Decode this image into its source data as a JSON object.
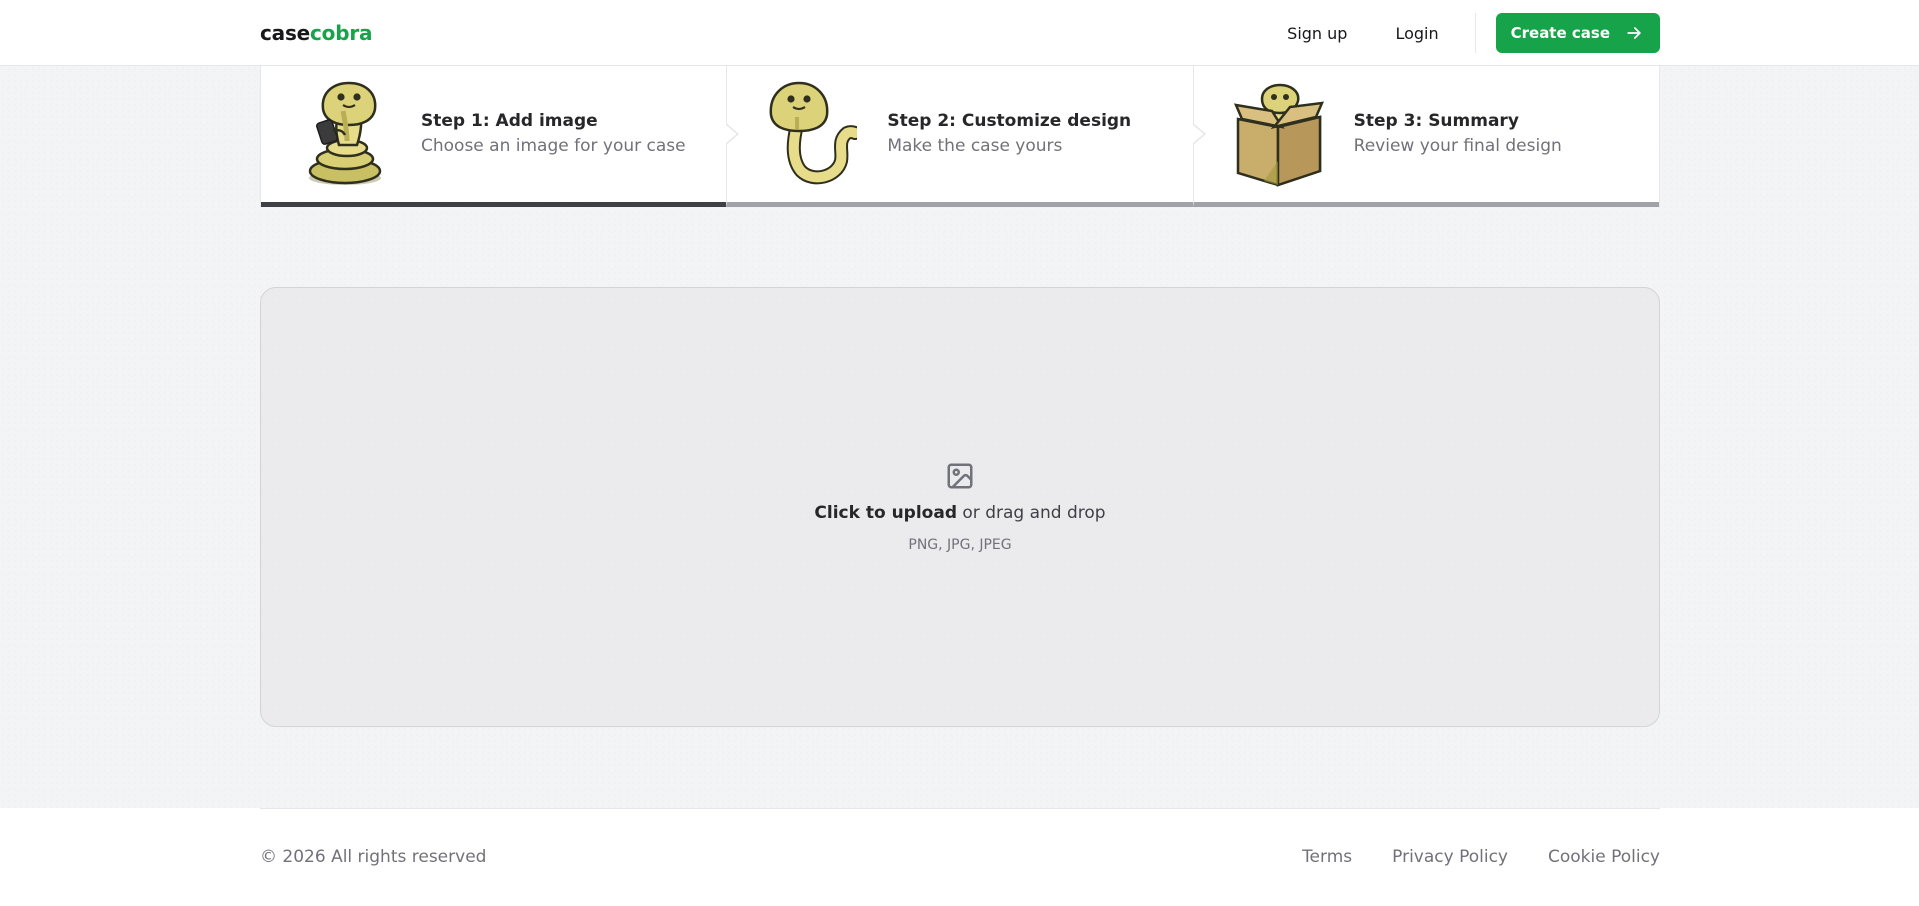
{
  "navbar": {
    "logo_part1": "case",
    "logo_part2": "cobra",
    "signup_label": "Sign up",
    "login_label": "Login",
    "create_label": "Create case"
  },
  "steps": [
    {
      "title": "Step 1: Add image",
      "description": "Choose an image for your case",
      "state": "current"
    },
    {
      "title": "Step 2: Customize design",
      "description": "Make the case yours",
      "state": "upcoming"
    },
    {
      "title": "Step 3: Summary",
      "description": "Review your final design",
      "state": "upcoming"
    }
  ],
  "upload": {
    "icon": "image-icon",
    "click_label": "Click to upload",
    "drag_label": " or drag and drop",
    "types": "PNG, JPG, JPEG"
  },
  "footer": {
    "copyright": "© 2026 All rights reserved",
    "links": [
      "Terms",
      "Privacy Policy",
      "Cookie Policy"
    ]
  },
  "colors": {
    "brand_green": "#16a34a",
    "active_step_bar": "#3f3f46",
    "inactive_step_bar": "#a1a1aa",
    "snake_body": "#e6dc8a",
    "snake_outline": "#2f2f1e",
    "box_color": "#c9ad6b"
  }
}
